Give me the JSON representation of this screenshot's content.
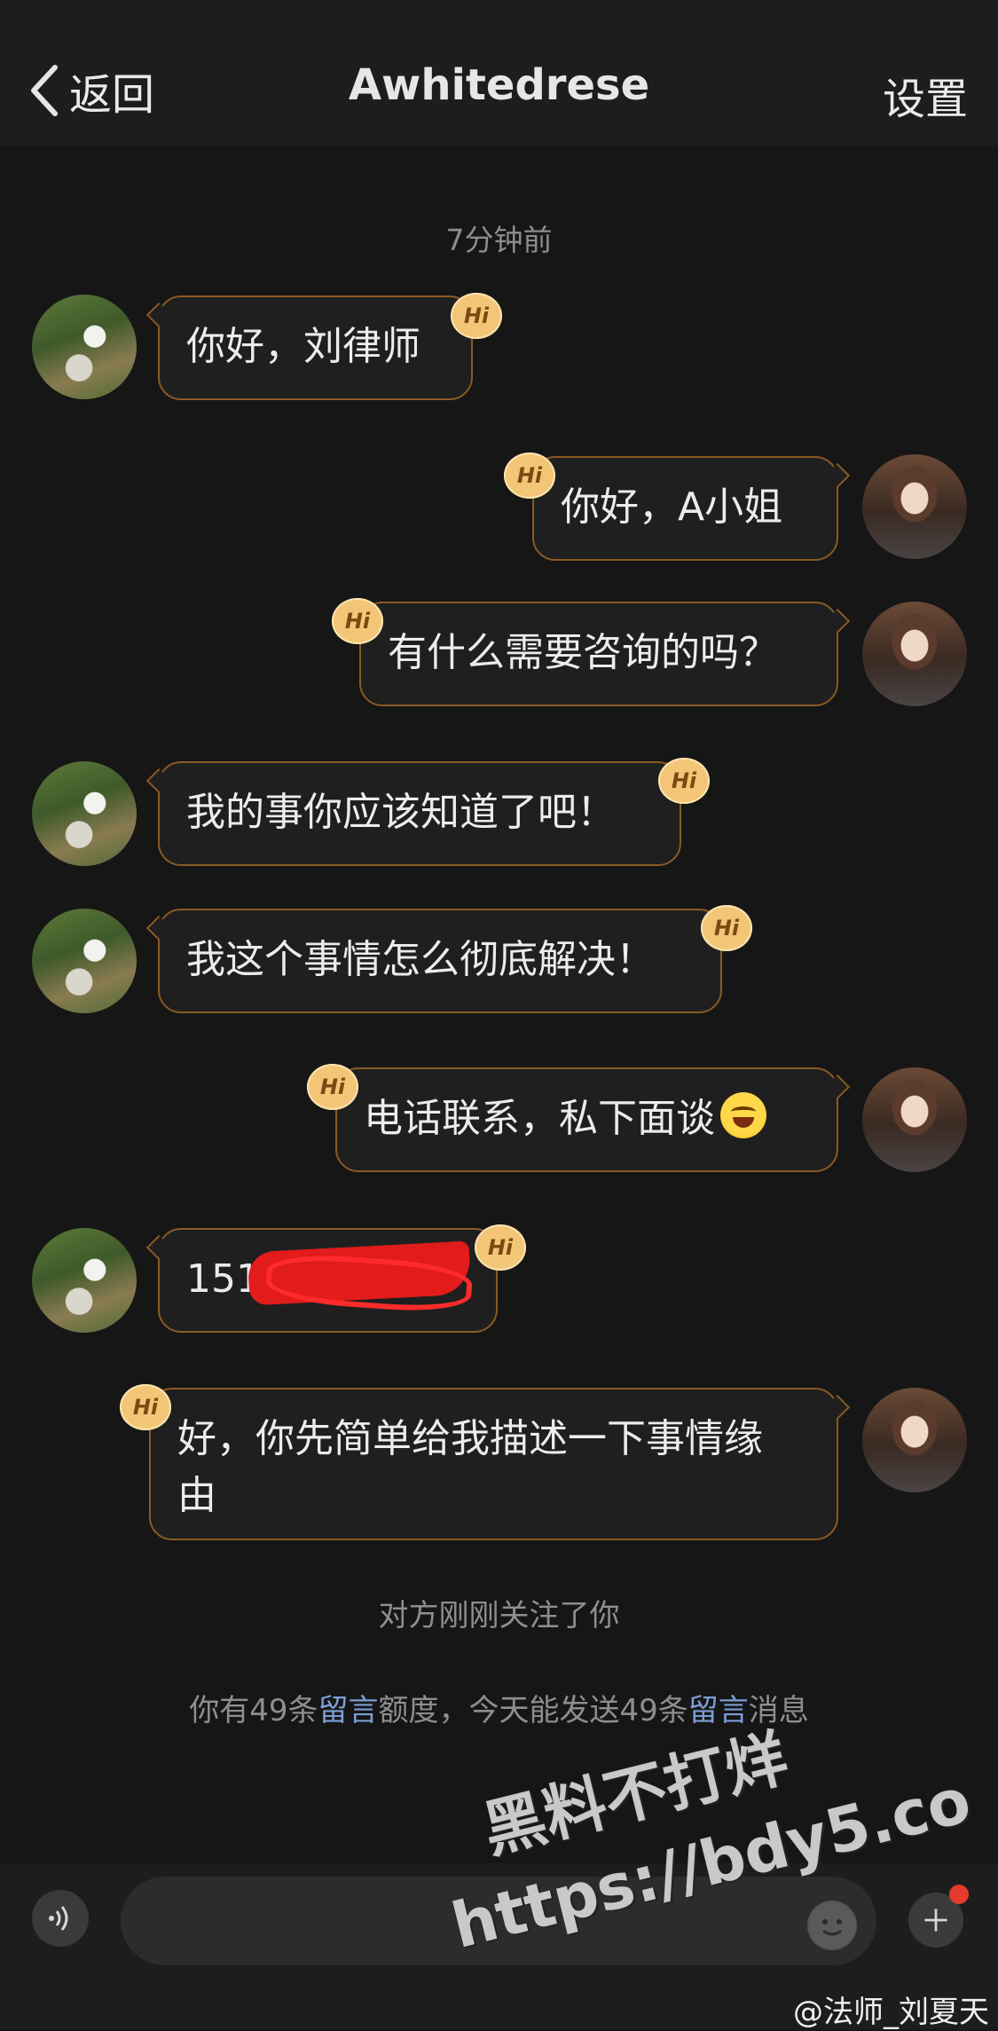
{
  "header": {
    "back_label": "返回",
    "title": "Awhitedrese",
    "settings_label": "设置"
  },
  "timestamp": "7分钟前",
  "messages": [
    {
      "side": "left",
      "text": "你好，刘律师"
    },
    {
      "side": "right",
      "text": "你好，A小姐"
    },
    {
      "side": "right",
      "text": "有什么需要咨询的吗？"
    },
    {
      "side": "left",
      "text": "我的事你应该知道了吧！"
    },
    {
      "side": "left",
      "text": "我这个事情怎么彻底解决！"
    },
    {
      "side": "right",
      "text": "电话联系，私下面谈"
    },
    {
      "side": "left",
      "text": "151"
    },
    {
      "side": "right",
      "text": "好，你先简单给我描述一下事情缘由"
    }
  ],
  "hi_badge": "Hi",
  "system": {
    "follow_notice": "对方刚刚关注了你",
    "quota_prefix": "你有49条",
    "quota_link1": "留言",
    "quota_middle": "额度，今天能发送49条",
    "quota_link2": "留言",
    "quota_suffix": "消息"
  },
  "watermark": {
    "line1": "黑料不打烊",
    "line2": "https://bdy5.co"
  },
  "input": {
    "placeholder": ""
  },
  "credit": "@法师_刘夏天",
  "icons": {
    "back": "chevron-left-icon",
    "voice": "voice-icon",
    "emoji": "emoji-icon",
    "plus": "plus-icon"
  }
}
